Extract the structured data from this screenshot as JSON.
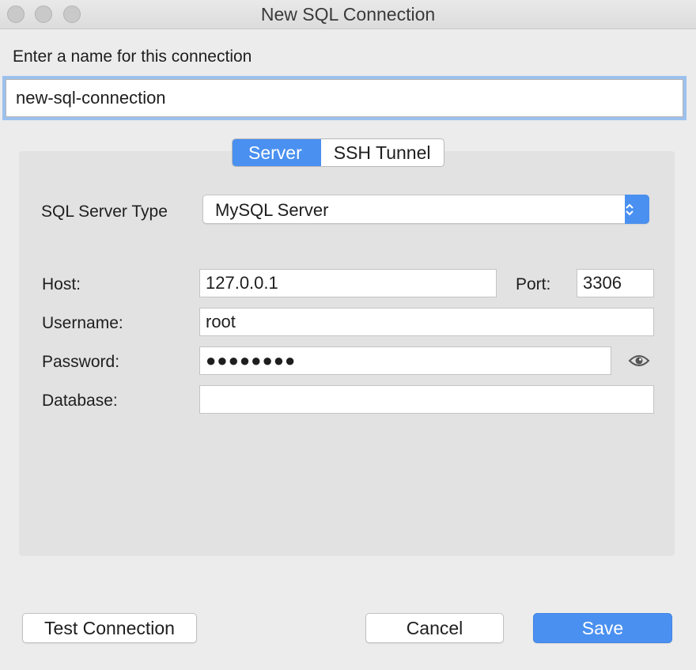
{
  "window": {
    "title": "New SQL Connection"
  },
  "connection_name": {
    "label": "Enter a name for this connection",
    "value": "new-sql-connection"
  },
  "tabs": [
    {
      "label": "Server",
      "active": true
    },
    {
      "label": "SSH Tunnel",
      "active": false
    }
  ],
  "server": {
    "type_label": "SQL Server Type",
    "type_value": "MySQL Server",
    "host_label": "Host:",
    "host_value": "127.0.0.1",
    "port_label": "Port:",
    "port_value": "3306",
    "username_label": "Username:",
    "username_value": "root",
    "password_label": "Password:",
    "password_value": "●●●●●●●●",
    "database_label": "Database:",
    "database_value": ""
  },
  "icons": {
    "stepper": "up-down-chevron-icon",
    "password_reveal": "eye-icon"
  },
  "buttons": {
    "test": "Test Connection",
    "cancel": "Cancel",
    "save": "Save"
  },
  "colors": {
    "accent": "#4a90f0",
    "focus_ring": "#9cc1ee",
    "background": "#ececec",
    "panel": "#e2e2e2"
  }
}
